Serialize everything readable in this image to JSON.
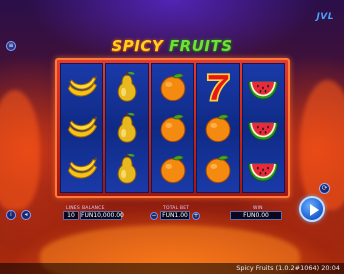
{
  "game": {
    "title_word1": "SPICY",
    "title_word2": "FRUITS",
    "brand": "JVL"
  },
  "reels": [
    [
      "banana",
      "banana",
      "banana"
    ],
    [
      "pear",
      "pear",
      "pear"
    ],
    [
      "orange",
      "orange",
      "orange"
    ],
    [
      "seven",
      "orange",
      "orange"
    ],
    [
      "watermelon",
      "watermelon",
      "watermelon"
    ]
  ],
  "controls": {
    "lines_label": "LINES",
    "lines_value": "10",
    "balance_label": "BALANCE",
    "balance_value": "FUN10,000.00",
    "totalbet_label": "TOTAL BET",
    "totalbet_value": "FUN1.00",
    "win_label": "WIN",
    "win_value": "FUN0.00",
    "minus": "−",
    "plus": "+"
  },
  "icons": {
    "menu": "hamburger-icon",
    "info": "info-icon",
    "sound": "speaker-icon",
    "autoplay": "autoplay-icon",
    "spin": "play-icon"
  },
  "status": {
    "version_text": "Spicy Fruits (1.0.2#1064) 20:04"
  },
  "colors": {
    "frame": "#e83a28",
    "reel_bg": "#1a3aa8",
    "spin": "#1a5ad0",
    "title_yellow": "#ffd21e",
    "title_green": "#6ee03a"
  }
}
